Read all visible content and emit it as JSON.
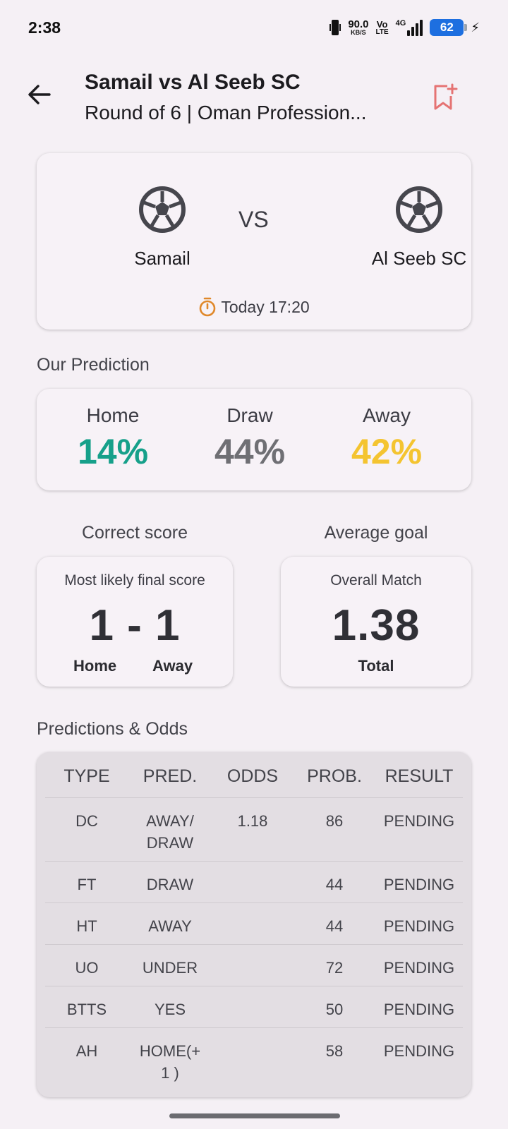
{
  "status_bar": {
    "time": "2:38",
    "net_speed_value": "90.0",
    "net_speed_unit": "KB/S",
    "volte_top": "Vo",
    "volte_bottom": "LTE",
    "network": "4G",
    "battery": "62"
  },
  "header": {
    "title": "Samail vs Al Seeb SC",
    "subtitle": "Round of 6 | Oman Profession..."
  },
  "match": {
    "home_team": "Samail",
    "away_team": "Al Seeb SC",
    "vs_label": "VS",
    "time": "Today 17:20"
  },
  "prediction": {
    "section_label": "Our Prediction",
    "home_label": "Home",
    "home_value": "14%",
    "draw_label": "Draw",
    "draw_value": "44%",
    "away_label": "Away",
    "away_value": "42%",
    "colors": {
      "home": "#16a08a",
      "draw": "#6f6f74",
      "away": "#f4c430"
    }
  },
  "correct_score": {
    "section_label": "Correct score",
    "caption": "Most likely final score",
    "score": "1 - 1",
    "home_label": "Home",
    "away_label": "Away"
  },
  "average_goal": {
    "section_label": "Average goal",
    "caption": "Overall Match",
    "value": "1.38",
    "footer": "Total"
  },
  "odds": {
    "section_label": "Predictions & Odds",
    "headers": [
      "TYPE",
      "PRED.",
      "ODDS",
      "PROB.",
      "RESULT"
    ],
    "rows": [
      [
        "DC",
        "AWAY/ DRAW",
        "1.18",
        "86",
        "PENDING"
      ],
      [
        "FT",
        "DRAW",
        "",
        "44",
        "PENDING"
      ],
      [
        "HT",
        "AWAY",
        "",
        "44",
        "PENDING"
      ],
      [
        "UO",
        "UNDER",
        "",
        "72",
        "PENDING"
      ],
      [
        "BTTS",
        "YES",
        "",
        "50",
        "PENDING"
      ],
      [
        "AH",
        "HOME(+1 )",
        "",
        "58",
        "PENDING"
      ]
    ]
  },
  "icons": {
    "back": "arrow-back-icon",
    "bookmark": "bookmark-add-icon",
    "team_logo": "soccer-ball-icon",
    "timer": "stopwatch-icon"
  },
  "colors": {
    "background": "#f5f0f5",
    "bookmark": "#e57373",
    "timer": "#e0882a"
  }
}
